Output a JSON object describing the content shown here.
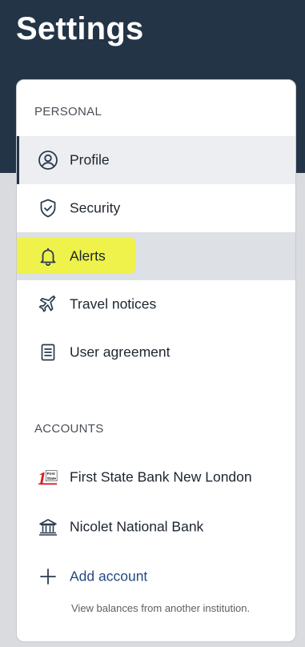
{
  "header": {
    "title": "Settings"
  },
  "personal": {
    "heading": "PERSONAL",
    "items": [
      {
        "label": "Profile",
        "icon": "user-circle-icon"
      },
      {
        "label": "Security",
        "icon": "shield-check-icon"
      },
      {
        "label": "Alerts",
        "icon": "bell-icon"
      },
      {
        "label": "Travel notices",
        "icon": "airplane-icon"
      },
      {
        "label": "User agreement",
        "icon": "document-icon"
      }
    ]
  },
  "accounts": {
    "heading": "ACCOUNTS",
    "items": [
      {
        "label": "First State Bank New London",
        "icon": "first-state-bank-logo",
        "logo_text": "First State"
      },
      {
        "label": "Nicolet National Bank",
        "icon": "bank-building-icon"
      }
    ],
    "add_account": {
      "label": "Add account",
      "icon": "plus-icon",
      "description": "View balances from another institution."
    }
  },
  "colors": {
    "header_bg": "#243447",
    "highlight": "#eef24a",
    "link": "#234a82"
  }
}
